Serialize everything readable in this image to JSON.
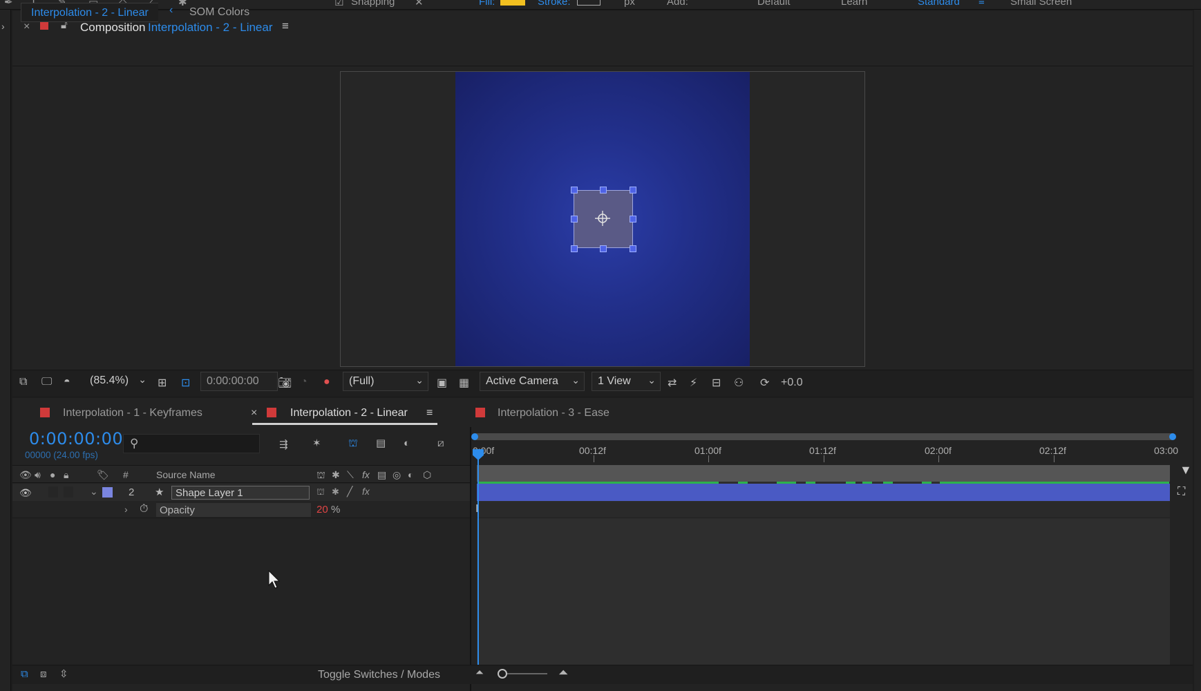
{
  "top_strip": {
    "snapping": "Snapping",
    "fill": "Fill:",
    "stroke": "Stroke:",
    "px": "px",
    "add": "Add:",
    "workspaces": [
      "Default",
      "Learn",
      "Standard",
      "Small Screen"
    ]
  },
  "composition": {
    "close": "×",
    "label": "Composition",
    "name": "Interpolation - 2 - Linear",
    "menu": "≡",
    "flowchart": [
      "Interpolation - 2 - Linear",
      "SOM Colors"
    ]
  },
  "viewer_bar": {
    "zoom": "(85.4%)",
    "time": "0:00:00:00",
    "resolution": "(Full)",
    "camera": "Active Camera",
    "views": "1 View",
    "exposure": "+0.0"
  },
  "timeline": {
    "tabs": [
      "Interpolation - 1 - Keyframes",
      "Interpolation - 2 - Linear",
      "Interpolation - 3 - Ease"
    ],
    "active_tab_close": "×",
    "timecode": "0:00:00:00",
    "fps": "00000 (24.00 fps)",
    "columns": {
      "number": "#",
      "source_name": "Source Name"
    },
    "layer": {
      "number": "2",
      "name": "Shape Layer 1"
    },
    "property": {
      "name": "Opacity",
      "value": "20",
      "unit": "%"
    },
    "ruler": [
      "0:00f",
      "00:12f",
      "01:00f",
      "01:12f",
      "02:00f",
      "02:12f",
      "03:00"
    ],
    "toggle_label": "Toggle Switches / Modes"
  },
  "colors": {
    "accent": "#2d8ceb",
    "comp_label": "#d03a3a",
    "layer_label": "#7a85e0",
    "layer_bar": "#4a5ac4"
  }
}
